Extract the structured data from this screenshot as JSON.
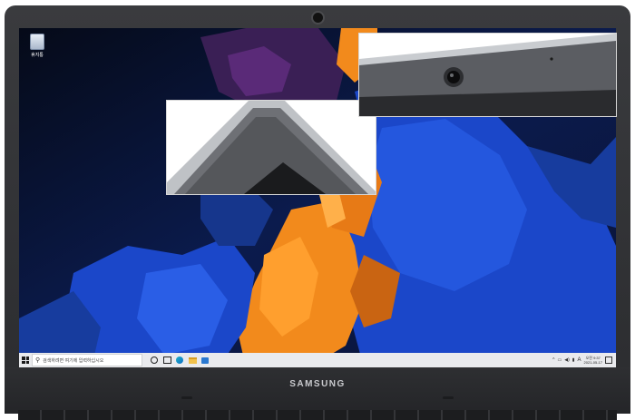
{
  "desktop": {
    "recycle_bin_label": "휴지통",
    "recycle_bin_icon": "recycle-bin-icon"
  },
  "taskbar": {
    "start_icon": "windows-logo-icon",
    "search_placeholder": "검색하려면 여기에 입력하십시오",
    "pinned": [
      "cortana-icon",
      "task-view-icon",
      "edge-icon",
      "file-explorer-icon",
      "store-icon"
    ],
    "tray": {
      "ime": "A",
      "time": "오전 9:37",
      "date": "2021-05-17"
    }
  },
  "device": {
    "brand": "SAMSUNG"
  },
  "colors": {
    "bezel": "#2b2c2f",
    "taskbar": "#e9eaed",
    "wallpaper_orange": "#f28a1c",
    "wallpaper_blue": "#1b47c9",
    "wallpaper_purple": "#5a2a78"
  }
}
